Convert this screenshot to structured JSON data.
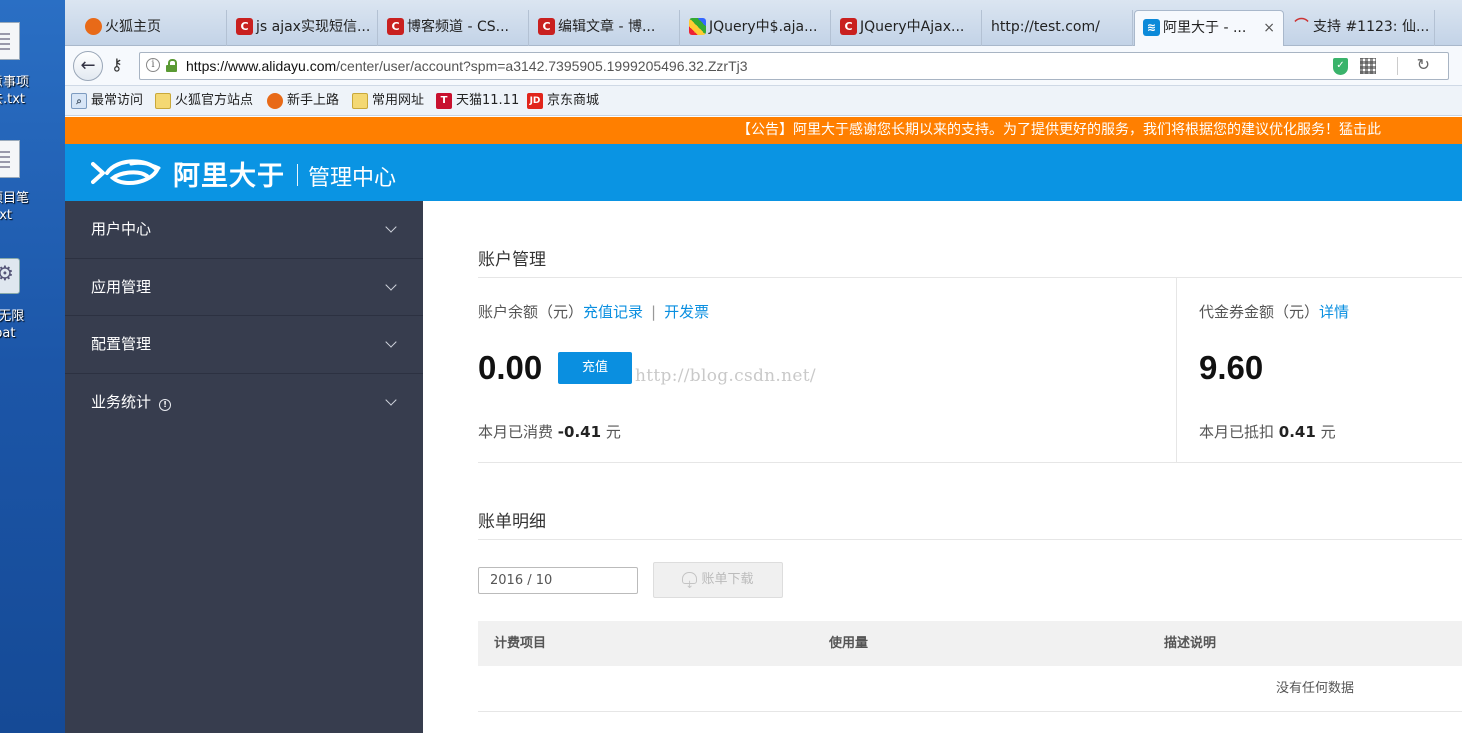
{
  "desktop": {
    "icons": [
      {
        "label1": "意事项",
        "label2": "去.txt",
        "icon": "text-file-icon"
      },
      {
        "label1": "项目笔",
        "label2": ".txt",
        "icon": "text-file-icon"
      },
      {
        "label1": "g无限",
        "label2": ".bat",
        "icon": "batch-file-icon"
      }
    ]
  },
  "browser": {
    "tabs": [
      {
        "title": "火狐主页",
        "icon": "firefox-icon"
      },
      {
        "title": "js ajax实现短信...",
        "icon": "csdn-icon"
      },
      {
        "title": "博客频道 - CS...",
        "icon": "csdn-icon"
      },
      {
        "title": "编辑文章 - 博...",
        "icon": "csdn-icon"
      },
      {
        "title": "JQuery中$.aja...",
        "icon": "jquery-icon"
      },
      {
        "title": "JQuery中Ajax...",
        "icon": "csdn-icon"
      },
      {
        "title": "http://test.com/",
        "icon": ""
      },
      {
        "title": "阿里大于 - ...",
        "icon": "alidayu-icon",
        "close": "×"
      },
      {
        "title": "支持 #1123: 仙...",
        "icon": "support-icon"
      }
    ],
    "url_host": "https://www.alidayu.com",
    "url_path": "/center/user/account?spm=a3142.7395905.1999205496.32.ZzrTj3",
    "bookmarks": [
      {
        "label": "最常访问",
        "icon": "search-icon"
      },
      {
        "label": "火狐官方站点",
        "icon": "folder-icon"
      },
      {
        "label": "新手上路",
        "icon": "firefox-icon"
      },
      {
        "label": "常用网址",
        "icon": "folder-icon"
      },
      {
        "label": "天猫11.11",
        "icon": "tmall-icon",
        "glyph": "T"
      },
      {
        "label": "京东商城",
        "icon": "jd-icon",
        "glyph": "JD"
      }
    ]
  },
  "page": {
    "notice": "【公告】阿里大于感谢您长期以来的支持。为了提供更好的服务，我们将根据您的建议优化服务！猛击此",
    "header": {
      "brand": "阿里大于",
      "subtitle": "管理中心",
      "accent": "#0a94e3"
    },
    "sidebar": [
      {
        "label": "用户中心"
      },
      {
        "label": "应用管理"
      },
      {
        "label": "配置管理"
      },
      {
        "label": "业务统计",
        "info": "!"
      }
    ],
    "account": {
      "title": "账户管理",
      "balance_label": "账户余额（元）",
      "recharge_record": "充值记录",
      "invoice": "开发票",
      "balance": "0.00",
      "recharge_btn": "充值",
      "month_spent_prefix": "本月已消费",
      "month_spent": "-0.41",
      "month_spent_unit": "元",
      "voucher_label": "代金券金额（元）",
      "voucher_detail": "详情",
      "voucher": "9.60",
      "month_deduct_prefix": "本月已抵扣",
      "month_deduct": "0.41",
      "month_deduct_unit": "元",
      "watermark": "http://blog.csdn.net/"
    },
    "bill": {
      "title": "账单明细",
      "date": "2016 / 10",
      "download_btn": "账单下载",
      "columns": [
        "计费项目",
        "使用量",
        "描述说明"
      ],
      "empty": "没有任何数据"
    }
  }
}
